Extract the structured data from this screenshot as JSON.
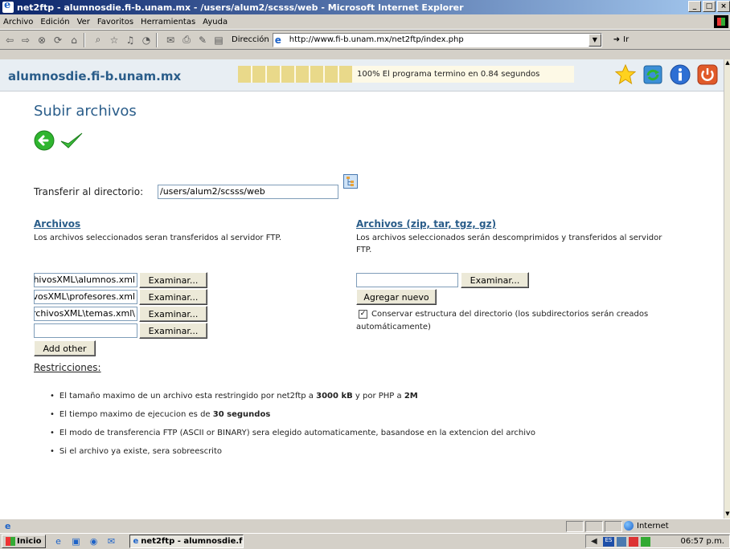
{
  "window": {
    "title": "net2ftp - alumnosdie.fi-b.unam.mx - /users/alum2/scsss/web - Microsoft Internet Explorer",
    "buttons": [
      "_",
      "□",
      "×"
    ]
  },
  "menu": [
    "Archivo",
    "Edición",
    "Ver",
    "Favoritos",
    "Herramientas",
    "Ayuda"
  ],
  "toolbar": {
    "address_label": "Dirección",
    "url": "http://www.fi-b.unam.mx/net2ftp/index.php",
    "go_label": "Ir"
  },
  "header": {
    "site": "alumnosdie.fi-b.unam.mx",
    "progress_fraction": 1.0,
    "progress_text": "100% El programa termino en 0.84 segundos",
    "icons": [
      "star-icon",
      "refresh-icon",
      "info-icon",
      "power-icon"
    ]
  },
  "page": {
    "title": "Subir archivos",
    "transfer_label": "Transferir al directorio:",
    "transfer_dir": "/users/alum2/scsss/web",
    "left": {
      "heading": "Archivos",
      "desc": "Los archivos seleccionados seran transferidos al servidor FTP.",
      "files": [
        "rchivosXML\\alumnos.xml",
        "hivosXML\\profesores.xml",
        "\\ArchivosXML\\temas.xml",
        ""
      ],
      "browse_label": "Examinar...",
      "add_other": "Add other"
    },
    "right": {
      "heading": "Archivos (zip, tar, tgz, gz)",
      "desc_line1": "Los archivos seleccionados serán descomprimidos y transferidos al servidor",
      "desc_line2": "FTP.",
      "file": "",
      "browse_label": "Examinar...",
      "add_new": "Agregar nuevo",
      "keep_structure_line1": "Conservar estructura del directorio (los subdirectorios serán creados",
      "keep_structure_line2": "automáticamente)",
      "keep_structure_checked": true
    },
    "restrictions_label": "Restricciones:",
    "restrictions": [
      {
        "pre": "El tamaño maximo de un archivo esta restringido por net2ftp a ",
        "b1": "3000 kB",
        "mid": " y por PHP a ",
        "b2": "2M",
        "post": ""
      },
      {
        "pre": "El tiempo maximo de ejecucion es de ",
        "b1": "30 segundos",
        "mid": "",
        "b2": "",
        "post": ""
      },
      {
        "pre": "El modo de transferencia FTP (ASCII or BINARY) sera elegido automaticamente, basandose en la extencion del archivo",
        "b1": "",
        "mid": "",
        "b2": "",
        "post": ""
      },
      {
        "pre": "Si el archivo ya existe, sera sobreescrito",
        "b1": "",
        "mid": "",
        "b2": "",
        "post": ""
      }
    ]
  },
  "statusbar": {
    "zone": "Internet"
  },
  "taskbar": {
    "start": "Inicio",
    "task": "net2ftp - alumnosdie.f...",
    "clock": "06:57 p.m.",
    "lang": "ES"
  }
}
